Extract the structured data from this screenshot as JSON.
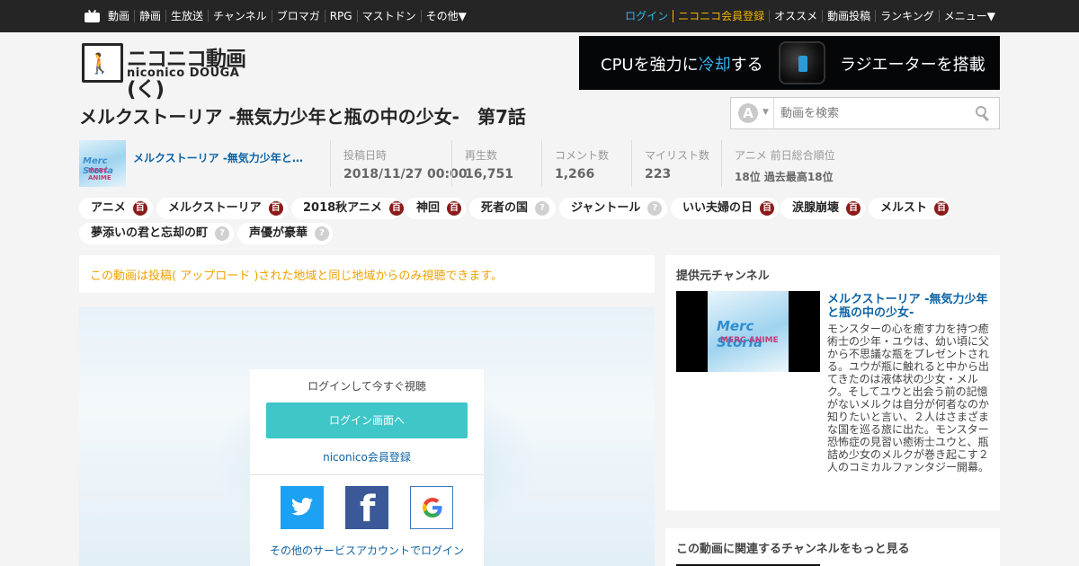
{
  "topbar": {
    "left": [
      "動画",
      "静画",
      "生放送",
      "チャンネル",
      "ブロマガ",
      "RPG",
      "マストドン",
      "その他▼"
    ],
    "right": {
      "login": "ログイン",
      "register": "ニコニコ会員登録",
      "items": [
        "オススメ",
        "動画投稿",
        "ランキング",
        "メニュー▼"
      ]
    }
  },
  "logo": {
    "ja": "ニコニコ動画(く)",
    "en": "niconico DOUGA"
  },
  "ad": {
    "pre": "CPUを強力に",
    "highlight": "冷却",
    "post": "する",
    "right": "ラジエーターを搭載"
  },
  "video": {
    "title": "メルクストーリア -無気力少年と瓶の中の少女-　第7話"
  },
  "search": {
    "placeholder": "動画を検索",
    "mode": "A",
    "arrow": "▼"
  },
  "channel": {
    "name": "メルクストーリア -無気力少年と瓶の中の少女-",
    "thumb_title": "Merc Storia",
    "thumb_sub": "MERC ANIME"
  },
  "stats": {
    "posted": {
      "label": "投稿日時",
      "value": "2018/11/27 00:00"
    },
    "views": {
      "label": "再生数",
      "value": "16,751"
    },
    "comments": {
      "label": "コメント数",
      "value": "1,266"
    },
    "mylist": {
      "label": "マイリスト数",
      "value": "223"
    },
    "rank": {
      "label": "アニメ  前日総合順位",
      "value": "18位  過去最高18位"
    }
  },
  "tags": [
    {
      "label": "アニメ",
      "badge": "百"
    },
    {
      "label": "メルクストーリア",
      "badge": "百"
    },
    {
      "label": "2018秋アニメ",
      "badge": "百"
    },
    {
      "label": "神回",
      "badge": "百"
    },
    {
      "label": "死者の国",
      "badge": "?"
    },
    {
      "label": "ジャントール",
      "badge": "?"
    },
    {
      "label": "いい夫婦の日",
      "badge": "百"
    },
    {
      "label": "涙腺崩壊",
      "badge": "百"
    },
    {
      "label": "メルスト",
      "badge": "百"
    },
    {
      "label": "夢添いの君と忘却の町",
      "badge": "?"
    },
    {
      "label": "声優が豪華",
      "badge": "?"
    }
  ],
  "notice": "この動画は投稿( アップロード )された地域と同じ地域からのみ視聴できます。",
  "login": {
    "prompt": "ログインして今すぐ視聴",
    "button": "ログイン画面へ",
    "register": "niconico会員登録",
    "other": "その他のサービスアカウントでログイン"
  },
  "side": {
    "provider_heading": "提供元チャンネル",
    "channel_title": "メルクストーリア -無気力少年と瓶の中の少女-",
    "description": "モンスターの心を癒す力を持つ癒術士の少年・ユウは、幼い頃に父から不思議な瓶をプレゼントされる。ユウが瓶に触れると中から出てきたのは液体状の少女・メルク。そしてユウと出会う前の記憶がないメルクは自分が何者なのか知りたいと言い、２人はさまざまな国を巡る旅に出た。モンスター恐怖症の見習い癒術士ユウと、瓶詰め少女のメルクが巻き起こす２人のコミカルファンタジー開幕。",
    "related_heading": "この動画に関連するチャンネルをもっと見る"
  },
  "colors": {
    "accent": "#0d63a5",
    "login_button": "#3fc6c8",
    "notice": "#f0a100",
    "topbar": "#252525",
    "tag_badge": "#8b1b1b"
  },
  "icons": {
    "tv": "niconico-tv-icon",
    "search": "search-icon",
    "twitter": "twitter-icon",
    "facebook": "facebook-icon",
    "google": "google-icon"
  }
}
